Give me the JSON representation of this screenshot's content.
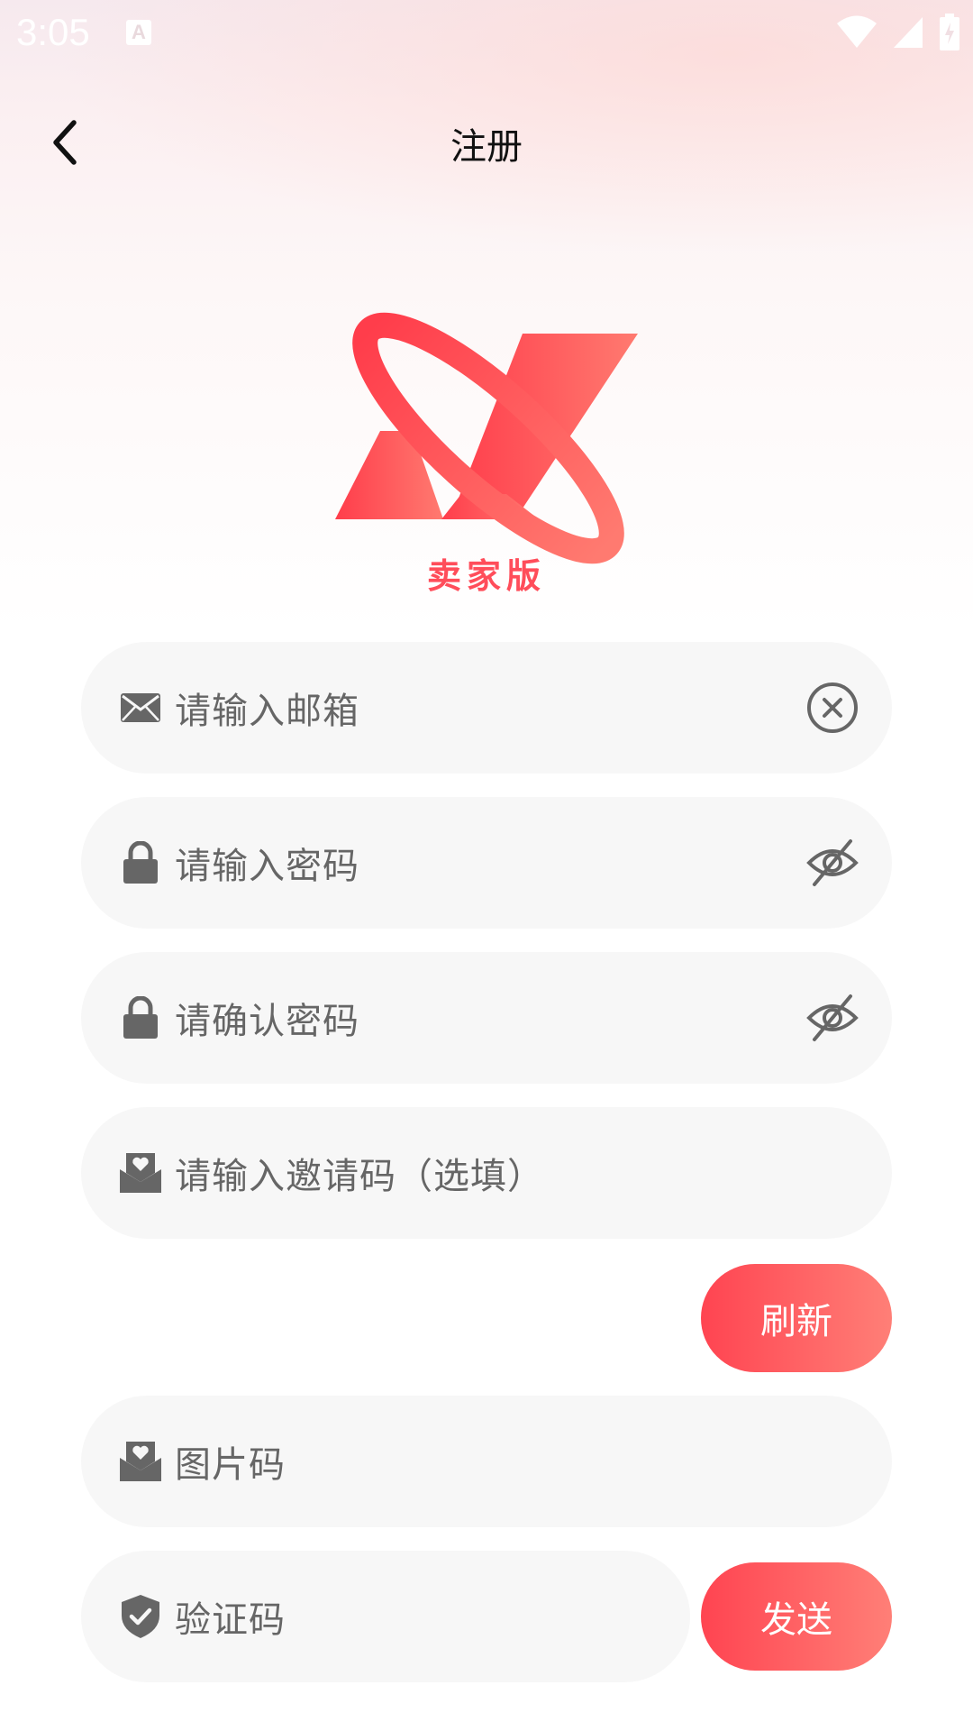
{
  "status_bar": {
    "time": "3:05",
    "notification_badge": "A"
  },
  "header": {
    "title": "注册"
  },
  "logo": {
    "caption": "卖家版"
  },
  "form": {
    "email_placeholder": "请输入邮箱",
    "password_placeholder": "请输入密码",
    "confirm_password_placeholder": "请确认密码",
    "invite_placeholder": "请输入邀请码（选填）",
    "refresh_label": "刷新",
    "captcha_placeholder": "图片码",
    "verify_placeholder": "验证码",
    "send_label": "发送"
  },
  "colors": {
    "accent_start": "#ff4451",
    "accent_end": "#ff7f77",
    "field_bg": "#f7f7f7",
    "icon_gray": "#666666"
  },
  "icons": [
    "back-arrow-icon",
    "mail-icon",
    "clear-icon",
    "lock-icon",
    "eye-off-icon",
    "invite-mail-icon",
    "shield-check-icon",
    "wifi-icon",
    "signal-icon",
    "battery-icon"
  ]
}
